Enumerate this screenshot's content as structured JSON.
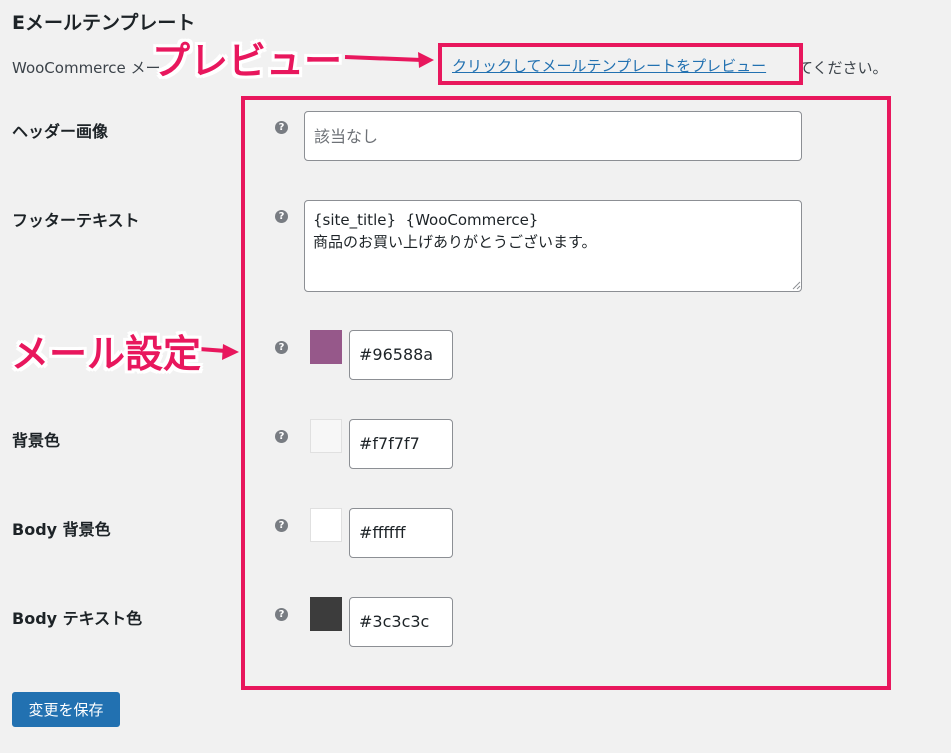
{
  "section": {
    "title": "Eメールテンプレート",
    "description_start": "WooCommerce メー",
    "preview_link": "クリックしてメールテンプレートをプレビュー",
    "description_end": "てください。"
  },
  "annotations": {
    "preview_callout": "プレビュー",
    "settings_callout": "メール設定",
    "accent_color": "#e8175d"
  },
  "rows": {
    "header_image": {
      "label": "ヘッダー画像",
      "placeholder": "該当なし"
    },
    "footer_text": {
      "label": "フッターテキスト",
      "value": "{site_title}  {WooCommerce}\n商品のお買い上げありがとうございます。"
    },
    "base_color": {
      "value": "#96588a"
    },
    "background_color": {
      "label": "背景色",
      "value": "#f7f7f7"
    },
    "body_background_color": {
      "label": "Body 背景色",
      "value": "#ffffff"
    },
    "body_text_color": {
      "label": "Body テキスト色",
      "value": "#3c3c3c"
    }
  },
  "help_icon_glyph": "?",
  "save_button": {
    "label": "変更を保存"
  }
}
